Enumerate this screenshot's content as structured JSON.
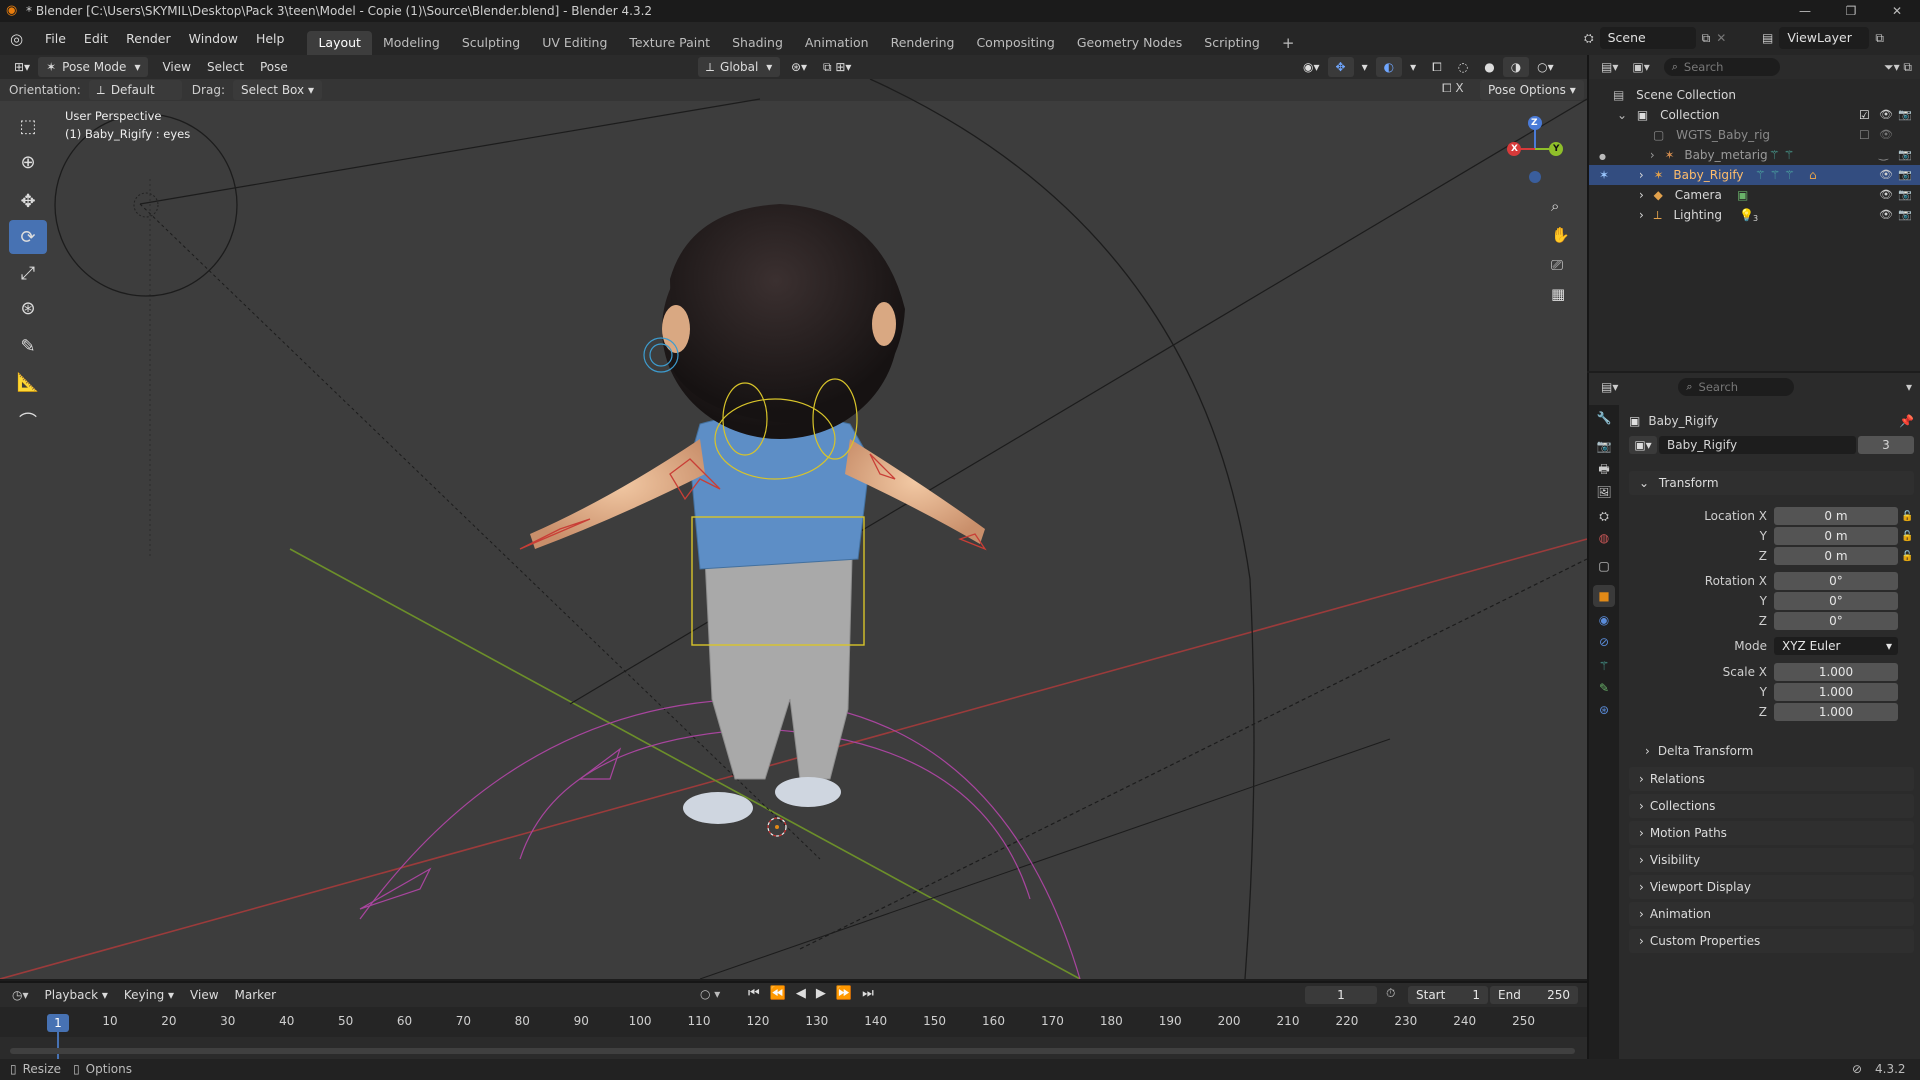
{
  "titlebar": {
    "title": "* Blender [C:\\Users\\SKYMIL\\Desktop\\Pack 3\\teen\\Model - Copie (1)\\Source\\Blender.blend] - Blender 4.3.2",
    "minimize": "—",
    "maximize": "❐",
    "close": "✕"
  },
  "menubar": {
    "menus": [
      "File",
      "Edit",
      "Render",
      "Window",
      "Help"
    ],
    "workspaces": [
      "Layout",
      "Modeling",
      "Sculpting",
      "UV Editing",
      "Texture Paint",
      "Shading",
      "Animation",
      "Rendering",
      "Compositing",
      "Geometry Nodes",
      "Scripting"
    ],
    "add_workspace": "+",
    "scene": "Scene",
    "view_layer": "ViewLayer"
  },
  "viewport_header": {
    "mode": "Pose Mode",
    "menus": [
      "View",
      "Select",
      "Pose"
    ],
    "transform_orientation": "Global",
    "orientation_label": "Orientation:",
    "orientation_value": "Default",
    "drag_label": "Drag:",
    "drag_value": "Select Box",
    "pose_options": "Pose Options"
  },
  "viewport": {
    "perspective": "User Perspective",
    "active": "(1) Baby_Rigify : eyes",
    "gizmo": {
      "x": "X",
      "y": "Y",
      "z": "Z"
    },
    "colors": {
      "x_axis": "#a33a3a",
      "y_axis": "#6c8f2a",
      "bg": "#3d3d3d"
    }
  },
  "outliner": {
    "search_placeholder": "Search",
    "scene_collection": "Scene Collection",
    "collection": "Collection",
    "items": [
      {
        "name": "WGTS_Baby_rig"
      },
      {
        "name": "Baby_metarig"
      },
      {
        "name": "Baby_Rigify",
        "selected": true
      },
      {
        "name": "Camera"
      },
      {
        "name": "Lighting",
        "badge": "3"
      }
    ]
  },
  "properties": {
    "search_placeholder": "Search",
    "object_name": "Baby_Rigify",
    "data_name": "Baby_Rigify",
    "users": "3",
    "transform": {
      "title": "Transform",
      "location_label": "Location X",
      "location": [
        "0 m",
        "0 m",
        "0 m"
      ],
      "rotation_label": "Rotation X",
      "rotation": [
        "0°",
        "0°",
        "0°"
      ],
      "mode_label": "Mode",
      "mode": "XYZ Euler",
      "scale_label": "Scale X",
      "scale": [
        "1.000",
        "1.000",
        "1.000"
      ],
      "y": "Y",
      "z": "Z",
      "delta": "Delta Transform"
    },
    "panels": [
      "Relations",
      "Collections",
      "Motion Paths",
      "Visibility",
      "Viewport Display",
      "Animation",
      "Custom Properties"
    ]
  },
  "timeline": {
    "menus": [
      "Playback",
      "Keying",
      "View",
      "Marker"
    ],
    "current_frame": "1",
    "start_label": "Start",
    "start": "1",
    "end_label": "End",
    "end": "250",
    "ticks": [
      "1",
      "10",
      "20",
      "30",
      "40",
      "50",
      "60",
      "70",
      "80",
      "90",
      "100",
      "110",
      "120",
      "130",
      "140",
      "150",
      "160",
      "170",
      "180",
      "190",
      "200",
      "210",
      "220",
      "230",
      "240",
      "250"
    ],
    "playhead": "1"
  },
  "statusbar": {
    "resize": "Resize",
    "options": "Options",
    "version": "4.3.2"
  }
}
